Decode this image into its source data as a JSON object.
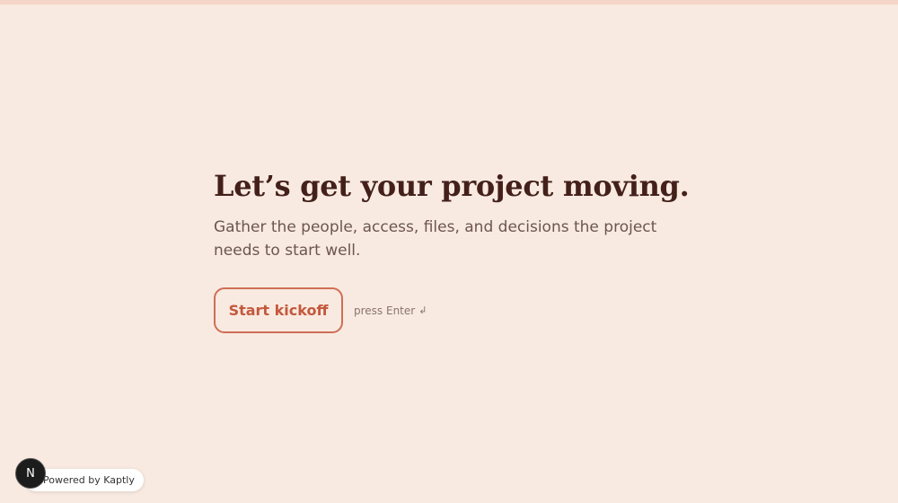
{
  "hero": {
    "headline": "Let’s get your project moving.",
    "subtitle": "Gather the people, access, files, and decisions the project needs to start well.",
    "start_label": "Start kickoff",
    "hint": "press Enter",
    "hint_icon": "↲"
  },
  "badge": {
    "avatar_letter": "N",
    "text": "Powered by Kaptly"
  },
  "colors": {
    "background": "#f8eae0",
    "accent": "#cf6e55",
    "headline": "#44201a"
  }
}
